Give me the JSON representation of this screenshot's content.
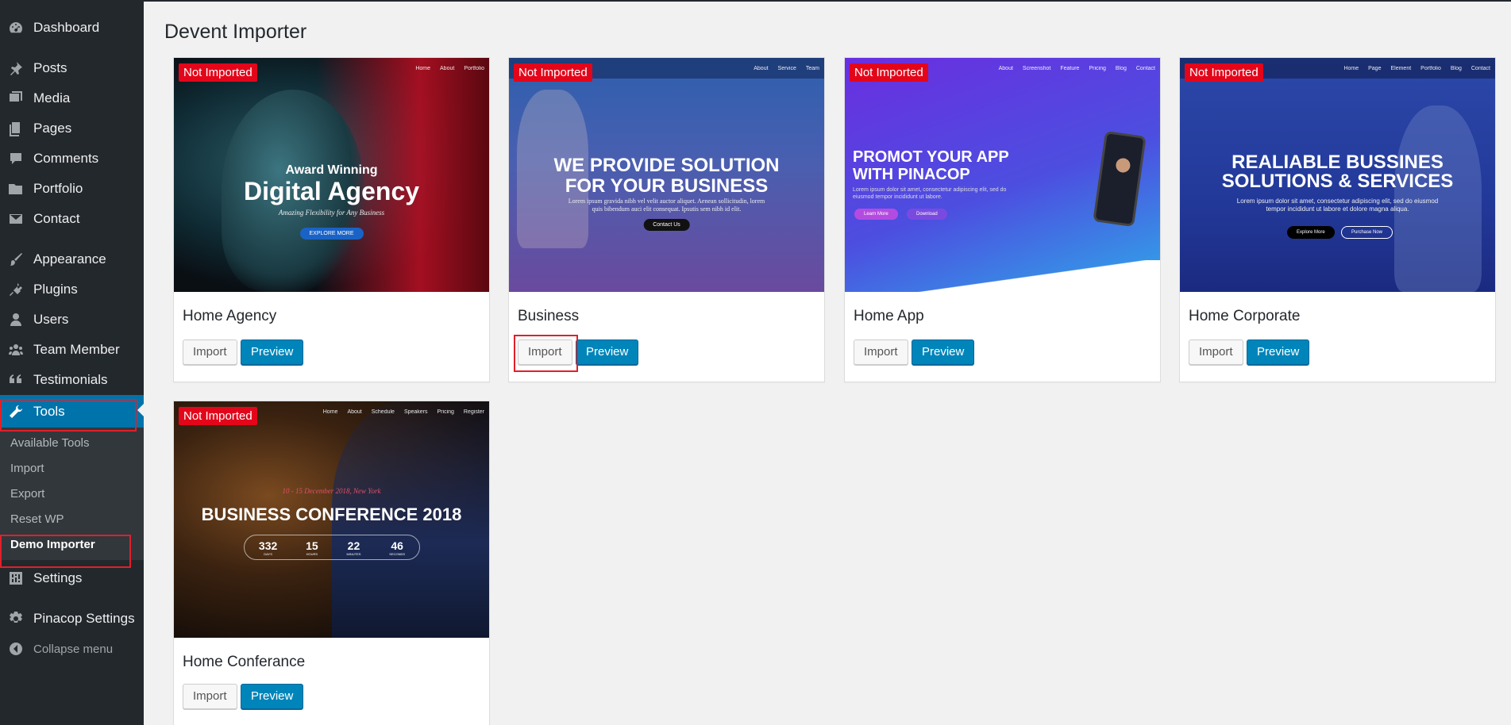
{
  "sidebar": {
    "items": [
      {
        "label": "Dashboard",
        "icon": "dashboard-icon"
      },
      {
        "label": "Posts",
        "icon": "pin-icon"
      },
      {
        "label": "Media",
        "icon": "media-icon"
      },
      {
        "label": "Pages",
        "icon": "pages-icon"
      },
      {
        "label": "Comments",
        "icon": "comment-icon"
      },
      {
        "label": "Portfolio",
        "icon": "folder-icon"
      },
      {
        "label": "Contact",
        "icon": "envelope-icon"
      },
      {
        "label": "Appearance",
        "icon": "brush-icon"
      },
      {
        "label": "Plugins",
        "icon": "plug-icon"
      },
      {
        "label": "Users",
        "icon": "user-icon"
      },
      {
        "label": "Team Member",
        "icon": "group-icon"
      },
      {
        "label": "Testimonials",
        "icon": "quote-icon"
      },
      {
        "label": "Tools",
        "icon": "wrench-icon"
      },
      {
        "label": "Settings",
        "icon": "sliders-icon"
      },
      {
        "label": "Pinacop Settings",
        "icon": "gear-icon"
      },
      {
        "label": "Collapse menu",
        "icon": "collapse-arrow-icon"
      }
    ],
    "tools_submenu": [
      "Available Tools",
      "Import",
      "Export",
      "Reset WP",
      "Demo Importer"
    ],
    "active_item": "Tools",
    "current_subitem": "Demo Importer"
  },
  "page": {
    "title": "Devent Importer"
  },
  "badge_text": "Not Imported",
  "import_label": "Import",
  "preview_label": "Preview",
  "demos": [
    {
      "title": "Home Agency",
      "thumb_nav": [
        "Home",
        "About",
        "Portfolio"
      ],
      "thumb_small_heading": "Award Winning",
      "thumb_heading": "Digital Agency",
      "thumb_sub": "Amazing Flexibility for Any Business",
      "thumb_buttons": [
        "EXPLORE MORE"
      ]
    },
    {
      "title": "Business",
      "thumb_nav": [
        "About",
        "Service",
        "Team"
      ],
      "thumb_heading_1": "WE PROVIDE SOLUTION",
      "thumb_heading_2": "FOR YOUR BUSINESS",
      "thumb_sub": "Lorem ipsum gravida nibh vel velit auctor aliquet. Aenean sollicitudin, lorem quis bibendum auci elit consequat. Ipsutis sem nibh id elit.",
      "thumb_buttons": [
        "Contact Us"
      ]
    },
    {
      "title": "Home App",
      "thumb_nav": [
        "About",
        "Screenshot",
        "Feature",
        "Pricing",
        "Blog",
        "Contact"
      ],
      "thumb_heading_1": "PROMOT YOUR APP",
      "thumb_heading_2": "WITH PINACOP",
      "thumb_sub": "Lorem ipsum dolor sit amet, consectetur adipiscing elit, sed do eiusmod tempor incididunt ut labore.",
      "thumb_buttons": [
        "Learn More",
        "Download"
      ]
    },
    {
      "title": "Home Corporate",
      "thumb_nav": [
        "Home",
        "Page",
        "Element",
        "Portfolio",
        "Blog",
        "Contact"
      ],
      "thumb_heading_1": "REALIABLE BUSSINES",
      "thumb_heading_2": "SOLUTIONS & SERVICES",
      "thumb_sub": "Lorem ipsum dolor sit amet, consectetur adipiscing elit, sed do eiusmod tempor incididunt ut labore et dolore magna aliqua.",
      "thumb_buttons": [
        "Explore More",
        "Purchase Now"
      ]
    },
    {
      "title": "Home Conferance",
      "thumb_nav": [
        "Home",
        "About",
        "Schedule",
        "Speakers",
        "Pricing",
        "Register"
      ],
      "thumb_date": "10 - 15 December 2018, New York",
      "thumb_heading": "BUSINESS CONFERENCE 2018",
      "countdown": [
        {
          "value": "332",
          "unit": "DAYS"
        },
        {
          "value": "15",
          "unit": "HOURS"
        },
        {
          "value": "22",
          "unit": "MINUTES"
        },
        {
          "value": "46",
          "unit": "SECONDS"
        }
      ]
    }
  ],
  "colors": {
    "sidebar_bg": "#23282d",
    "active_blue": "#0073aa",
    "preview_blue": "#0085ba",
    "badge_red": "#e3061a",
    "highlight_red": "#e0202a"
  }
}
